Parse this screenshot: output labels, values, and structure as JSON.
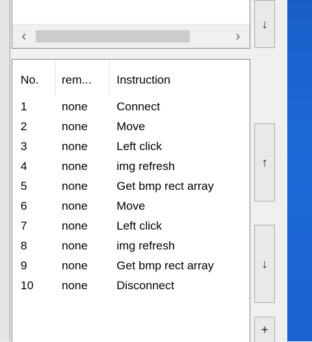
{
  "top_panel": {
    "scroll_left_glyph": "‹",
    "scroll_right_glyph": "›"
  },
  "list": {
    "headers": {
      "no": "No.",
      "rem": "rem...",
      "instruction": "Instruction"
    },
    "rows": [
      {
        "no": "1",
        "rem": "none",
        "instruction": "Connect"
      },
      {
        "no": "2",
        "rem": "none",
        "instruction": "Move"
      },
      {
        "no": "3",
        "rem": "none",
        "instruction": "Left click"
      },
      {
        "no": "4",
        "rem": "none",
        "instruction": "img refresh"
      },
      {
        "no": "5",
        "rem": "none",
        "instruction": "Get bmp rect array"
      },
      {
        "no": "6",
        "rem": "none",
        "instruction": "Move"
      },
      {
        "no": "7",
        "rem": "none",
        "instruction": "Left click"
      },
      {
        "no": "8",
        "rem": "none",
        "instruction": "img refresh"
      },
      {
        "no": "9",
        "rem": "none",
        "instruction": "Get bmp rect array"
      },
      {
        "no": "10",
        "rem": "none",
        "instruction": "Disconnect"
      }
    ]
  },
  "buttons": {
    "top_down": "↓",
    "move_up": "↑",
    "move_down": "↓",
    "add": "+"
  }
}
